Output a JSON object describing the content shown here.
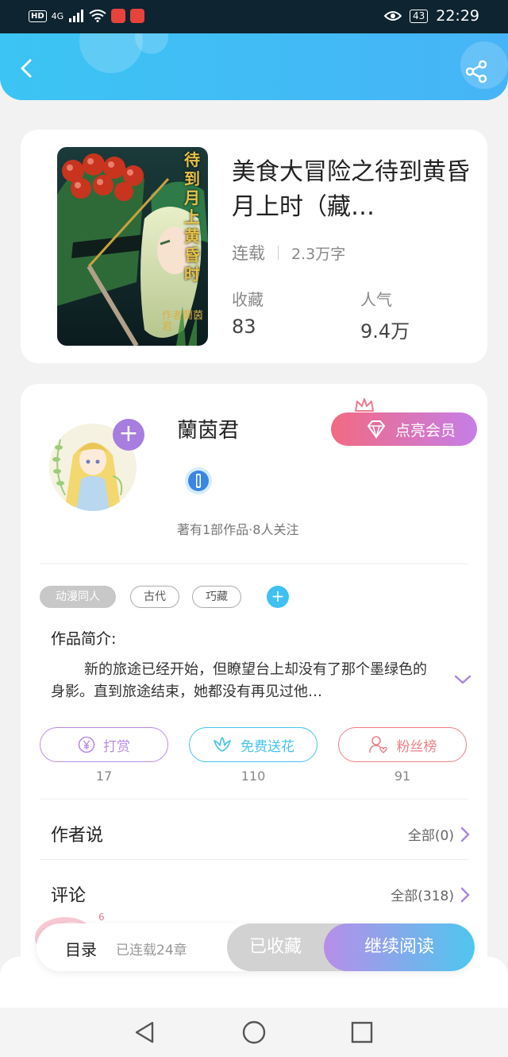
{
  "status_bar": {
    "network": "HD",
    "signal": "4G",
    "battery": "43",
    "time": "22:29"
  },
  "book": {
    "title": "美食大冒险之待到黄昏月上时（藏…",
    "status": "连载",
    "word_count": "2.3万字",
    "collect_label": "收藏",
    "collect_value": "83",
    "popularity_label": "人气",
    "popularity_value": "9.4万",
    "cover_text": "待到月上黄昏时",
    "cover_signature": "作者蘭茵君"
  },
  "author": {
    "name": "蘭茵君",
    "stats": "著有1部作品·8人关注",
    "vip_button": "点亮会员"
  },
  "tags": [
    "动漫同人",
    "古代",
    "巧藏"
  ],
  "intro": {
    "title": "作品简介:",
    "text": "新的旅途已经开始，但瞭望台上却没有了那个墨绿色的身影。直到旅途结束，她都没有再见过他…"
  },
  "actions": [
    {
      "label": "打赏",
      "count": "17",
      "color": "#b98ce6"
    },
    {
      "label": "免费送花",
      "count": "110",
      "color": "#45c3ec"
    },
    {
      "label": "粉丝榜",
      "count": "91",
      "color": "#ee7f86"
    }
  ],
  "rows": {
    "author_says": "作者说",
    "author_says_link": "全部(0)",
    "comments": "评论",
    "comments_link": "全部(318)"
  },
  "bottom_bar": {
    "toc": "目录",
    "toc_count": "已连载24章",
    "collected": "已收藏",
    "read": "继续阅读"
  },
  "icons": {
    "back": "chevron-left-icon",
    "share": "share-icon",
    "vip": "diamond-icon",
    "crown": "crown-icon",
    "expand": "chevron-down-icon",
    "reward": "yen-icon",
    "flower": "flower-icon",
    "fans": "user-heart-icon",
    "nav_back": "triangle-back-icon",
    "nav_home": "circle-home-icon",
    "nav_recent": "square-recent-icon"
  }
}
